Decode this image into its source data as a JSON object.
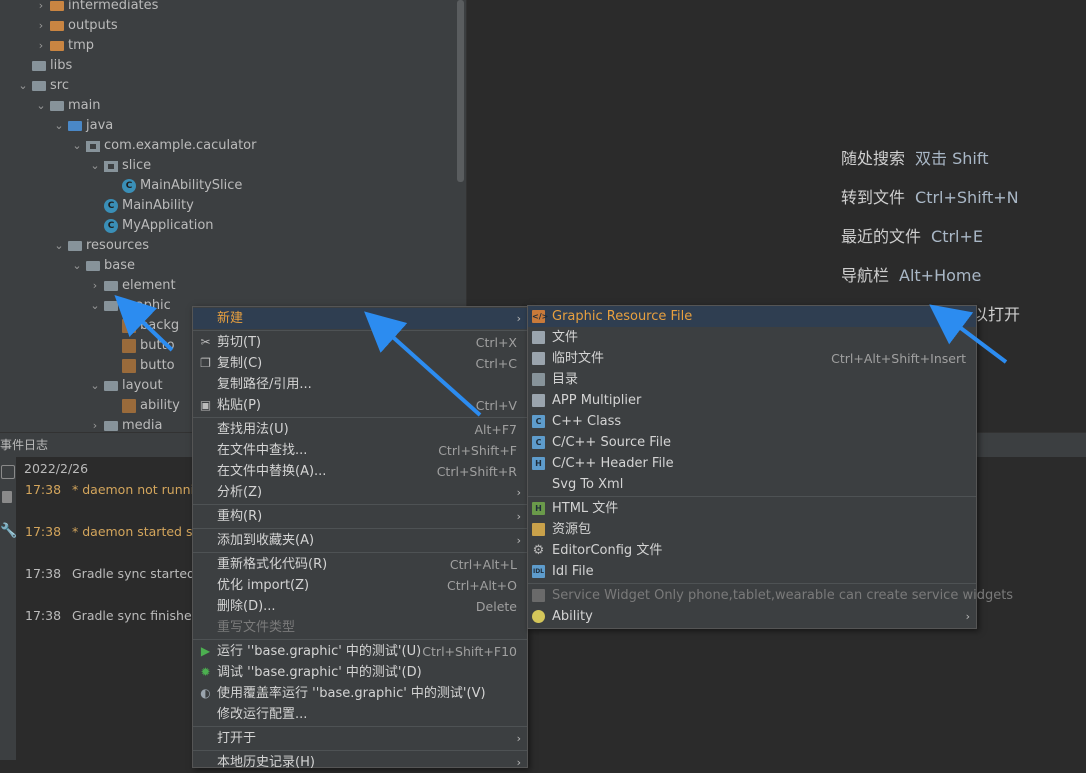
{
  "project_tree": {
    "items": [
      {
        "label": "intermediates",
        "indent": 3,
        "arrow": "›",
        "icon": "folder-orange-icon"
      },
      {
        "label": "outputs",
        "indent": 3,
        "arrow": "›",
        "icon": "folder-orange-icon"
      },
      {
        "label": "tmp",
        "indent": 3,
        "arrow": "›",
        "icon": "folder-orange-icon"
      },
      {
        "label": "libs",
        "indent": 2,
        "arrow": "",
        "icon": "folder-icon"
      },
      {
        "label": "src",
        "indent": 2,
        "arrow": "⌄",
        "icon": "folder-icon"
      },
      {
        "label": "main",
        "indent": 3,
        "arrow": "⌄",
        "icon": "folder-icon"
      },
      {
        "label": "java",
        "indent": 4,
        "arrow": "⌄",
        "icon": "folder-blue-icon"
      },
      {
        "label": "com.example.caculator",
        "indent": 5,
        "arrow": "⌄",
        "icon": "package-icon"
      },
      {
        "label": "slice",
        "indent": 6,
        "arrow": "⌄",
        "icon": "package-icon"
      },
      {
        "label": "MainAbilitySlice",
        "indent": 7,
        "arrow": "",
        "icon": "class-icon"
      },
      {
        "label": "MainAbility",
        "indent": 6,
        "arrow": "",
        "icon": "class-icon"
      },
      {
        "label": "MyApplication",
        "indent": 6,
        "arrow": "",
        "icon": "class-icon"
      },
      {
        "label": "resources",
        "indent": 4,
        "arrow": "⌄",
        "icon": "resources-folder-icon"
      },
      {
        "label": "base",
        "indent": 5,
        "arrow": "⌄",
        "icon": "folder-icon"
      },
      {
        "label": "element",
        "indent": 6,
        "arrow": "›",
        "icon": "folder-icon"
      },
      {
        "label": "graphic",
        "indent": 6,
        "arrow": "⌄",
        "icon": "folder-icon"
      },
      {
        "label": "backg",
        "indent": 7,
        "arrow": "",
        "icon": "xml-file-icon"
      },
      {
        "label": "butto",
        "indent": 7,
        "arrow": "",
        "icon": "xml-file-icon"
      },
      {
        "label": "butto",
        "indent": 7,
        "arrow": "",
        "icon": "xml-file-icon"
      },
      {
        "label": "layout",
        "indent": 6,
        "arrow": "⌄",
        "icon": "folder-icon"
      },
      {
        "label": "ability",
        "indent": 7,
        "arrow": "",
        "icon": "xml-file-icon"
      },
      {
        "label": "media",
        "indent": 6,
        "arrow": "›",
        "icon": "folder-icon"
      }
    ]
  },
  "editor_hints": [
    {
      "label": "随处搜索",
      "key": "双击 Shift"
    },
    {
      "label": "转到文件",
      "key": "Ctrl+Shift+N"
    },
    {
      "label": "最近的文件",
      "key": "Ctrl+E"
    },
    {
      "label": "导航栏",
      "key": "Alt+Home"
    },
    {
      "label": "",
      "key": "以打开"
    }
  ],
  "event_log": {
    "title": "事件日志",
    "date": "2022/2/26",
    "entries": [
      {
        "time": "17:38",
        "message": "* daemon not runnin",
        "warn": true
      },
      {
        "time": "17:38",
        "message": "* daemon started su",
        "warn": true
      },
      {
        "time": "17:38",
        "message": "Gradle sync started",
        "warn": false
      },
      {
        "time": "17:38",
        "message": "Gradle sync finished",
        "warn": false
      }
    ]
  },
  "context_menu": {
    "items": [
      {
        "label": "新建",
        "shortcut": "",
        "submenu": true,
        "highlighted": true,
        "icon": ""
      },
      {
        "sep": true
      },
      {
        "label": "剪切(T)",
        "shortcut": "Ctrl+X",
        "icon": "scissors-icon"
      },
      {
        "label": "复制(C)",
        "shortcut": "Ctrl+C",
        "icon": "copy-icon"
      },
      {
        "label": "复制路径/引用...",
        "shortcut": "",
        "icon": ""
      },
      {
        "label": "粘贴(P)",
        "shortcut": "Ctrl+V",
        "icon": "paste-icon"
      },
      {
        "sep": true
      },
      {
        "label": "查找用法(U)",
        "shortcut": "Alt+F7",
        "icon": ""
      },
      {
        "label": "在文件中查找...",
        "shortcut": "Ctrl+Shift+F",
        "icon": ""
      },
      {
        "label": "在文件中替换(A)...",
        "shortcut": "Ctrl+Shift+R",
        "icon": ""
      },
      {
        "label": "分析(Z)",
        "shortcut": "",
        "submenu": true,
        "icon": ""
      },
      {
        "sep": true
      },
      {
        "label": "重构(R)",
        "shortcut": "",
        "submenu": true,
        "icon": ""
      },
      {
        "sep": true
      },
      {
        "label": "添加到收藏夹(A)",
        "shortcut": "",
        "submenu": true,
        "icon": ""
      },
      {
        "sep": true
      },
      {
        "label": "重新格式化代码(R)",
        "shortcut": "Ctrl+Alt+L",
        "icon": ""
      },
      {
        "label": "优化 import(Z)",
        "shortcut": "Ctrl+Alt+O",
        "icon": ""
      },
      {
        "label": "删除(D)...",
        "shortcut": "Delete",
        "icon": ""
      },
      {
        "label": "重写文件类型",
        "shortcut": "",
        "disabled": true,
        "icon": ""
      },
      {
        "sep": true
      },
      {
        "label": "运行 ''base.graphic' 中的测试'(U)",
        "shortcut": "Ctrl+Shift+F10",
        "icon": "run-icon"
      },
      {
        "label": "调试 ''base.graphic' 中的测试'(D)",
        "shortcut": "",
        "icon": "debug-icon"
      },
      {
        "label": "使用覆盖率运行 ''base.graphic' 中的测试'(V)",
        "shortcut": "",
        "icon": "coverage-icon"
      },
      {
        "label": "修改运行配置...",
        "shortcut": "",
        "icon": ""
      },
      {
        "sep": true
      },
      {
        "label": "打开于",
        "shortcut": "",
        "submenu": true,
        "icon": ""
      },
      {
        "sep": true
      },
      {
        "label": "本地历史记录(H)",
        "shortcut": "",
        "submenu": true,
        "icon": ""
      }
    ]
  },
  "new_submenu": {
    "items": [
      {
        "label": "Graphic Resource File",
        "shortcut": "",
        "highlighted": true,
        "icon": "graphic-resource-file-icon",
        "color": "#c97a3a",
        "glyph": "</>"
      },
      {
        "label": "文件",
        "shortcut": "",
        "icon": "file-icon",
        "color": "#9aa4ad",
        "glyph": ""
      },
      {
        "label": "临时文件",
        "shortcut": "Ctrl+Alt+Shift+Insert",
        "icon": "scratch-file-icon",
        "color": "#9aa4ad",
        "glyph": ""
      },
      {
        "label": "目录",
        "shortcut": "",
        "icon": "directory-icon",
        "color": "#87939a",
        "glyph": ""
      },
      {
        "label": "APP Multiplier",
        "shortcut": "",
        "icon": "app-multiplier-icon",
        "color": "#9aa4ad",
        "glyph": ""
      },
      {
        "label": "C++ Class",
        "shortcut": "",
        "icon": "cpp-class-icon",
        "color": "#5e9ccc",
        "glyph": "C"
      },
      {
        "label": "C/C++ Source File",
        "shortcut": "",
        "icon": "cpp-source-icon",
        "color": "#5e9ccc",
        "glyph": "C"
      },
      {
        "label": "C/C++ Header File",
        "shortcut": "",
        "icon": "cpp-header-icon",
        "color": "#5e9ccc",
        "glyph": "H"
      },
      {
        "label": "Svg To Xml",
        "shortcut": "",
        "icon": "",
        "color": "",
        "glyph": ""
      },
      {
        "sep": true
      },
      {
        "label": "HTML 文件",
        "shortcut": "",
        "icon": "html-file-icon",
        "color": "#6a9a4a",
        "glyph": "H"
      },
      {
        "label": "资源包",
        "shortcut": "",
        "icon": "resource-bundle-icon",
        "color": "#c9a14a",
        "glyph": ""
      },
      {
        "label": "EditorConfig 文件",
        "shortcut": "",
        "icon": "gear-icon",
        "color": "",
        "glyph": "⚙"
      },
      {
        "label": "Idl File",
        "shortcut": "",
        "icon": "idl-file-icon",
        "color": "#5e9ccc",
        "glyph": "IDL"
      },
      {
        "sep": true
      },
      {
        "label": "Service Widget Only phone,tablet,wearable can create service widgets",
        "shortcut": "",
        "disabled": true,
        "icon": "puzzle-icon",
        "color": "#6a6a6a",
        "glyph": ""
      },
      {
        "label": "Ability",
        "shortcut": "",
        "submenu": true,
        "icon": "ability-icon",
        "color": "#d4c65a",
        "glyph": ""
      }
    ]
  }
}
